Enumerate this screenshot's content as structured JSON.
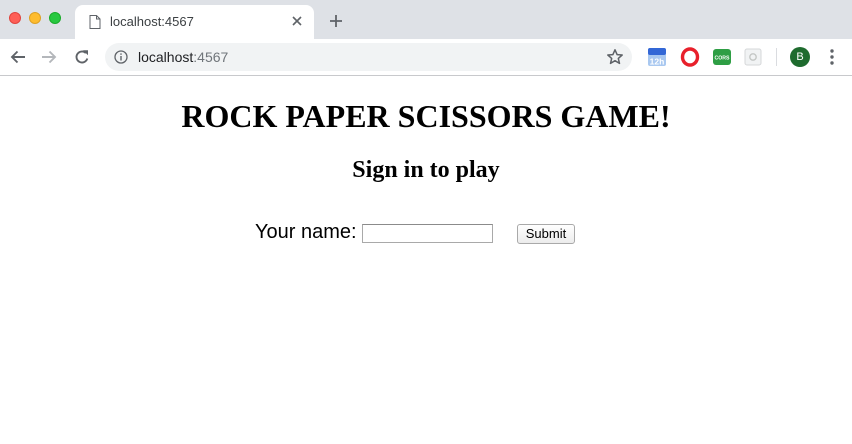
{
  "browser": {
    "tab": {
      "title": "localhost:4567"
    },
    "address": {
      "host": "localhost",
      "port": ":4567"
    },
    "extensions": [
      {
        "icon": "calendar-12h-icon",
        "text": "12h",
        "color": "#3367d6"
      },
      {
        "icon": "opera-vpn-icon",
        "color": "#e8202b"
      },
      {
        "icon": "cors-icon",
        "text": "CORS",
        "color": "#2e9e44"
      },
      {
        "icon": "puzzle-extension-icon",
        "color": "#c4c7c5"
      }
    ],
    "profile": {
      "initial": "B",
      "color": "#1e6b2e"
    }
  },
  "page": {
    "title": "ROCK PAPER SCISSORS GAME!",
    "subtitle": "Sign in to play",
    "form": {
      "name_label": "Your name:",
      "name_value": "",
      "submit_label": "Submit"
    }
  }
}
